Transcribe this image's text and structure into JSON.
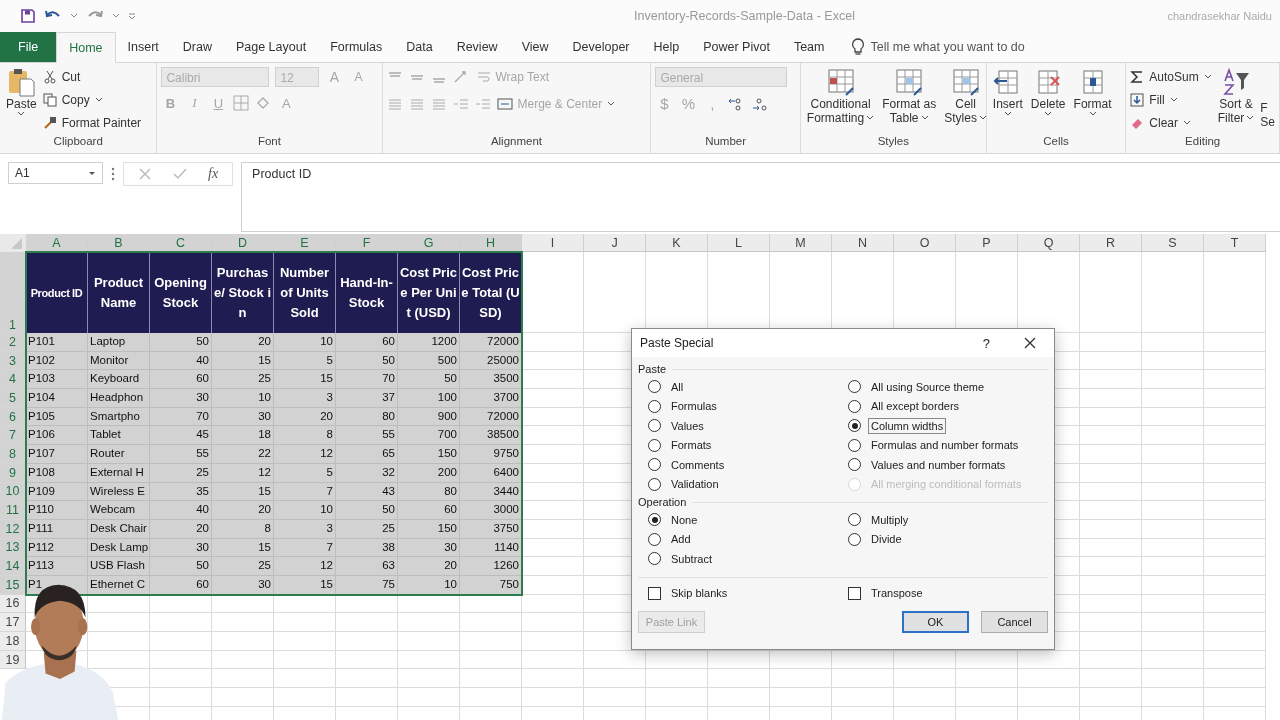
{
  "window": {
    "title": "Inventory-Records-Sample-Data  -  Excel",
    "user": "chandrasekhar Naidu"
  },
  "ribbon_tabs": [
    {
      "label": "File",
      "kind": "file",
      "selected": false
    },
    {
      "label": "Home",
      "kind": "tab",
      "selected": true
    },
    {
      "label": "Insert",
      "kind": "tab",
      "selected": false
    },
    {
      "label": "Draw",
      "kind": "tab",
      "selected": false
    },
    {
      "label": "Page Layout",
      "kind": "tab",
      "selected": false
    },
    {
      "label": "Formulas",
      "kind": "tab",
      "selected": false
    },
    {
      "label": "Data",
      "kind": "tab",
      "selected": false
    },
    {
      "label": "Review",
      "kind": "tab",
      "selected": false
    },
    {
      "label": "View",
      "kind": "tab",
      "selected": false
    },
    {
      "label": "Developer",
      "kind": "tab",
      "selected": false
    },
    {
      "label": "Help",
      "kind": "tab",
      "selected": false
    },
    {
      "label": "Power Pivot",
      "kind": "tab",
      "selected": false
    },
    {
      "label": "Team",
      "kind": "tab",
      "selected": false
    }
  ],
  "tell_me": {
    "placeholder": "Tell me what you want to do"
  },
  "clipboard": {
    "label": "Clipboard",
    "paste": "Paste",
    "cut": "Cut",
    "copy": "Copy",
    "format_painter": "Format Painter"
  },
  "font": {
    "label": "Font",
    "disabled": true,
    "name": "Calibri",
    "size": "12",
    "grow": "A",
    "shrink": "A",
    "styles": [
      "B",
      "I",
      "U"
    ],
    "color_button": "A"
  },
  "alignment": {
    "label": "Alignment",
    "disabled": true,
    "wrap_text": "Wrap Text",
    "merge_center": "Merge & Center"
  },
  "number": {
    "label": "Number",
    "disabled": true,
    "format": "General",
    "symbols": [
      "$",
      "%",
      ","
    ]
  },
  "styles": {
    "label": "Styles",
    "buttons": [
      [
        "Conditional",
        "Formatting"
      ],
      [
        "Format as",
        "Table"
      ],
      [
        "Cell",
        "Styles"
      ]
    ]
  },
  "cells": {
    "label": "Cells",
    "buttons": [
      "Insert",
      "Delete",
      "Format"
    ]
  },
  "editing": {
    "label": "Editing",
    "autosum": "AutoSum",
    "fill": "Fill",
    "clear": "Clear",
    "sort_filter": [
      "Sort &",
      "Filter"
    ],
    "find_select": [
      "F",
      "Se"
    ]
  },
  "formula_bar": {
    "name_box": "A1",
    "fx": "fx",
    "value": "Product ID"
  },
  "sheet": {
    "columns": [
      {
        "label": "A",
        "selected": true
      },
      {
        "label": "B",
        "selected": true
      },
      {
        "label": "C",
        "selected": true
      },
      {
        "label": "D",
        "selected": true
      },
      {
        "label": "E",
        "selected": true
      },
      {
        "label": "F",
        "selected": true
      },
      {
        "label": "G",
        "selected": true
      },
      {
        "label": "H",
        "selected": true
      },
      {
        "label": "I",
        "selected": false
      },
      {
        "label": "J",
        "selected": false
      },
      {
        "label": "K",
        "selected": false
      },
      {
        "label": "L",
        "selected": false
      },
      {
        "label": "M",
        "selected": false
      },
      {
        "label": "N",
        "selected": false
      },
      {
        "label": "O",
        "selected": false
      },
      {
        "label": "P",
        "selected": false
      },
      {
        "label": "Q",
        "selected": false
      },
      {
        "label": "R",
        "selected": false
      },
      {
        "label": "S",
        "selected": false
      },
      {
        "label": "T",
        "selected": false
      }
    ],
    "header_row": {
      "number": "1",
      "selected": true,
      "cells": [
        "Product ID",
        "Product Name",
        "Opening Stock",
        "Purchase/ Stock in",
        "Number of Units Sold",
        "Hand-In-Stock",
        "Cost Price Per Unit (USD)",
        "Cost Price Total (USD)"
      ]
    },
    "rows": [
      {
        "number": "2",
        "selected": true,
        "cells": [
          "P101",
          "Laptop",
          "50",
          "20",
          "10",
          "60",
          "1200",
          "72000"
        ]
      },
      {
        "number": "3",
        "selected": true,
        "cells": [
          "P102",
          "Monitor",
          "40",
          "15",
          "5",
          "50",
          "500",
          "25000"
        ]
      },
      {
        "number": "4",
        "selected": true,
        "cells": [
          "P103",
          "Keyboard",
          "60",
          "25",
          "15",
          "70",
          "50",
          "3500"
        ]
      },
      {
        "number": "5",
        "selected": true,
        "cells": [
          "P104",
          "Headphon",
          "30",
          "10",
          "3",
          "37",
          "100",
          "3700"
        ]
      },
      {
        "number": "6",
        "selected": true,
        "cells": [
          "P105",
          "Smartpho",
          "70",
          "30",
          "20",
          "80",
          "900",
          "72000"
        ]
      },
      {
        "number": "7",
        "selected": true,
        "cells": [
          "P106",
          "Tablet",
          "45",
          "18",
          "8",
          "55",
          "700",
          "38500"
        ]
      },
      {
        "number": "8",
        "selected": true,
        "cells": [
          "P107",
          "Router",
          "55",
          "22",
          "12",
          "65",
          "150",
          "9750"
        ]
      },
      {
        "number": "9",
        "selected": true,
        "cells": [
          "P108",
          "External H",
          "25",
          "12",
          "5",
          "32",
          "200",
          "6400"
        ]
      },
      {
        "number": "10",
        "selected": true,
        "cells": [
          "P109",
          "Wireless E",
          "35",
          "15",
          "7",
          "43",
          "80",
          "3440"
        ]
      },
      {
        "number": "11",
        "selected": true,
        "cells": [
          "P110",
          "Webcam",
          "40",
          "20",
          "10",
          "50",
          "60",
          "3000"
        ]
      },
      {
        "number": "12",
        "selected": true,
        "cells": [
          "P111",
          "Desk Chair",
          "20",
          "8",
          "3",
          "25",
          "150",
          "3750"
        ]
      },
      {
        "number": "13",
        "selected": true,
        "cells": [
          "P112",
          "Desk Lamp",
          "30",
          "15",
          "7",
          "38",
          "30",
          "1140"
        ]
      },
      {
        "number": "14",
        "selected": true,
        "cells": [
          "P113",
          "USB Flash",
          "50",
          "25",
          "12",
          "63",
          "20",
          "1260"
        ]
      },
      {
        "number": "15",
        "selected": true,
        "cells": [
          "P1",
          "Ethernet C",
          "60",
          "30",
          "15",
          "75",
          "10",
          "750"
        ]
      },
      {
        "number": "16",
        "selected": false,
        "cells": []
      },
      {
        "number": "17",
        "selected": false,
        "cells": []
      },
      {
        "number": "18",
        "selected": false,
        "cells": []
      },
      {
        "number": "19",
        "selected": false,
        "cells": []
      }
    ]
  },
  "paste_special": {
    "title": "Paste Special",
    "help": "?",
    "paste": {
      "label": "Paste",
      "columns": [
        [
          {
            "label": "All",
            "selected": false,
            "disabled": false
          },
          {
            "label": "Formulas",
            "selected": false,
            "disabled": false
          },
          {
            "label": "Values",
            "selected": false,
            "disabled": false
          },
          {
            "label": "Formats",
            "selected": false,
            "disabled": false
          },
          {
            "label": "Comments",
            "selected": false,
            "disabled": false
          },
          {
            "label": "Validation",
            "selected": false,
            "disabled": false
          }
        ],
        [
          {
            "label": "All using Source theme",
            "selected": false,
            "disabled": false
          },
          {
            "label": "All except borders",
            "selected": false,
            "disabled": false
          },
          {
            "label": "Column widths",
            "selected": true,
            "disabled": false
          },
          {
            "label": "Formulas and number formats",
            "selected": false,
            "disabled": false
          },
          {
            "label": "Values and number formats",
            "selected": false,
            "disabled": false
          },
          {
            "label": "All merging conditional formats",
            "selected": false,
            "disabled": true
          }
        ]
      ]
    },
    "operation": {
      "label": "Operation",
      "columns": [
        [
          {
            "label": "None",
            "selected": true
          },
          {
            "label": "Add",
            "selected": false
          },
          {
            "label": "Subtract",
            "selected": false
          }
        ],
        [
          {
            "label": "Multiply",
            "selected": false
          },
          {
            "label": "Divide",
            "selected": false
          }
        ]
      ]
    },
    "options": [
      {
        "label": "Skip blanks",
        "checked": false
      },
      {
        "label": "Transpose",
        "checked": false
      }
    ],
    "buttons": [
      {
        "label": "Paste Link",
        "disabled": true,
        "default": false
      },
      {
        "label": "OK",
        "disabled": false,
        "default": true
      },
      {
        "label": "Cancel",
        "disabled": false,
        "default": false
      }
    ]
  }
}
